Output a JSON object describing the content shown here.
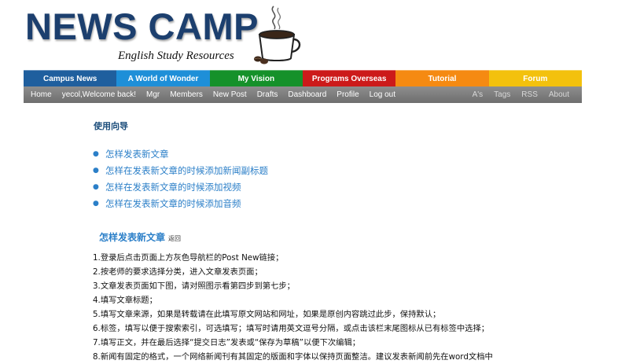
{
  "header": {
    "title": "NEWS CAMP",
    "subtitle": "English Study Resources",
    "logo_icon": "coffee-cup-icon"
  },
  "colored_nav": [
    {
      "label": "Campus News",
      "color": "#1f5f9e"
    },
    {
      "label": "A World of Wonder",
      "color": "#1e8fd8"
    },
    {
      "label": "My Vision",
      "color": "#15912a"
    },
    {
      "label": "Programs Overseas",
      "color": "#cc1a1a"
    },
    {
      "label": "Tutorial",
      "color": "#f58a12"
    },
    {
      "label": "Forum",
      "color": "#f3c10d"
    }
  ],
  "grey_nav": {
    "left": [
      "Home",
      "yecol,Welcome back!",
      "Mgr",
      "Members",
      "New Post",
      "Drafts",
      "Dashboard",
      "Profile",
      "Log out"
    ],
    "right": [
      "A's",
      "Tags",
      "RSS",
      "About"
    ]
  },
  "guide": {
    "heading": "使用向导",
    "links": [
      "怎样发表新文章",
      "怎样在发表新文章的时候添加新闻副标题",
      "怎样在发表新文章的时候添加视频",
      "怎样在发表新文章的时候添加音频"
    ]
  },
  "section": {
    "title": "怎样发表新文章",
    "back_label": "返回",
    "steps": [
      "1.登录后点击页面上方灰色导航栏的Post New链接；",
      "2.按老师的要求选择分类，进入文章发表页面；",
      "3.文章发表页面如下图，请对照图示看第四步到第七步；",
      "4.填写文章标题；",
      "5.填写文章来源，如果是转载请在此填写原文网站和网址，如果是原创内容跳过此步，保持默认；",
      "6.标签，填写以便于搜索索引，可选填写；填写时请用英文逗号分隔，或点击该栏末尾图标从已有标签中选择；",
      "7.填写正文，并在最后选择“提交日志”发表或“保存为草稿”以便下次编辑；",
      "8.新闻有固定的格式，一个网络新闻刊有其固定的版面和字体以保持页面整洁。建议发表新闻前先在word文档中"
    ]
  }
}
